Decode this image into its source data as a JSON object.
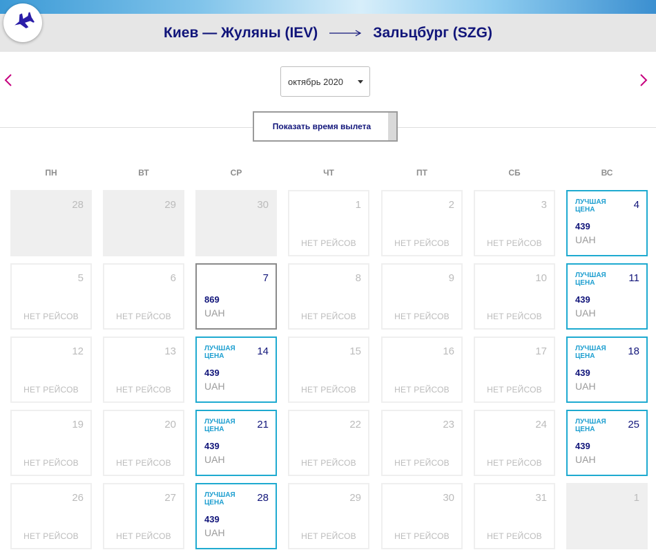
{
  "route": {
    "origin": "Киев — Жуляны (IEV)",
    "destination": "Зальцбург (SZG)"
  },
  "month": {
    "selected": "октябрь 2020"
  },
  "toggle_label": "Показать время вылета",
  "colors": {
    "brand": "#11157a",
    "best_border": "#1eaad0",
    "nav_arrow": "#c6007e"
  },
  "weekdays": [
    "ПН",
    "ВТ",
    "СР",
    "ЧТ",
    "ПТ",
    "СБ",
    "ВС"
  ],
  "labels": {
    "no_flights": "НЕТ РЕЙСОВ",
    "best_price": "ЛУЧШАЯ ЦЕНА",
    "currency": "UAH"
  },
  "days": [
    {
      "day": "28",
      "status": "outside"
    },
    {
      "day": "29",
      "status": "outside"
    },
    {
      "day": "30",
      "status": "outside"
    },
    {
      "day": "1",
      "status": "none"
    },
    {
      "day": "2",
      "status": "none"
    },
    {
      "day": "3",
      "status": "none"
    },
    {
      "day": "4",
      "status": "best",
      "price": "439"
    },
    {
      "day": "5",
      "status": "none"
    },
    {
      "day": "6",
      "status": "none"
    },
    {
      "day": "7",
      "status": "selected",
      "price": "869"
    },
    {
      "day": "8",
      "status": "none"
    },
    {
      "day": "9",
      "status": "none"
    },
    {
      "day": "10",
      "status": "none"
    },
    {
      "day": "11",
      "status": "best",
      "price": "439"
    },
    {
      "day": "12",
      "status": "none"
    },
    {
      "day": "13",
      "status": "none"
    },
    {
      "day": "14",
      "status": "best",
      "price": "439"
    },
    {
      "day": "15",
      "status": "none"
    },
    {
      "day": "16",
      "status": "none"
    },
    {
      "day": "17",
      "status": "none"
    },
    {
      "day": "18",
      "status": "best",
      "price": "439"
    },
    {
      "day": "19",
      "status": "none"
    },
    {
      "day": "20",
      "status": "none"
    },
    {
      "day": "21",
      "status": "best",
      "price": "439"
    },
    {
      "day": "22",
      "status": "none"
    },
    {
      "day": "23",
      "status": "none"
    },
    {
      "day": "24",
      "status": "none"
    },
    {
      "day": "25",
      "status": "best",
      "price": "439"
    },
    {
      "day": "26",
      "status": "none"
    },
    {
      "day": "27",
      "status": "none"
    },
    {
      "day": "28",
      "status": "best",
      "price": "439"
    },
    {
      "day": "29",
      "status": "none"
    },
    {
      "day": "30",
      "status": "none"
    },
    {
      "day": "31",
      "status": "none"
    },
    {
      "day": "1",
      "status": "outside"
    }
  ]
}
